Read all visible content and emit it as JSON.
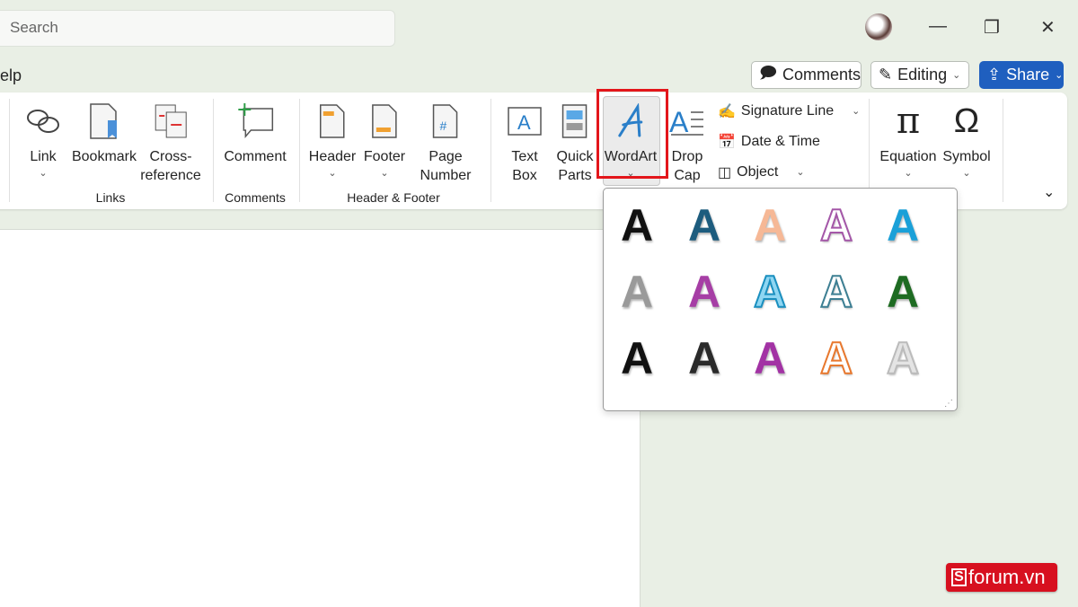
{
  "titlebar": {
    "search_placeholder": "Search",
    "minimize": "—",
    "restore": "❐",
    "close": "✕"
  },
  "menu": {
    "partial_tab": "elp"
  },
  "header_buttons": {
    "comments": "Comments",
    "editing": "Editing",
    "share": "Share",
    "chevron": "⌄"
  },
  "ribbon": {
    "link": "Link",
    "bookmark": "Bookmark",
    "cross1": "Cross-",
    "cross2": "reference",
    "comment": "Comment",
    "header": "Header",
    "footer": "Footer",
    "page1": "Page",
    "page2": "Number",
    "textbox1": "Text",
    "textbox2": "Box",
    "quick1": "Quick",
    "quick2": "Parts",
    "wordart": "WordArt",
    "drop1": "Drop",
    "drop2": "Cap",
    "signature": "Signature Line",
    "datetime": "Date & Time",
    "object": "Object",
    "equation": "Equation",
    "symbol": "Symbol",
    "groups": {
      "links": "Links",
      "comments": "Comments",
      "headerfooter": "Header & Footer"
    },
    "chev": "⌄",
    "collapse": "⌄"
  },
  "wordart_gallery": {
    "items": [
      {
        "letter": "A",
        "color": "#111111"
      },
      {
        "letter": "A",
        "color": "#1d5c7e"
      },
      {
        "letter": "A",
        "color": "#f6b896"
      },
      {
        "letter": "A",
        "color": "#ffffff",
        "outline": "#a457a8"
      },
      {
        "letter": "A",
        "color": "#1aa0d8"
      },
      {
        "letter": "A",
        "color": "#9a9a9a"
      },
      {
        "letter": "A",
        "color": "#a63ea5"
      },
      {
        "letter": "A",
        "color": "#8fd6f2",
        "outline": "#1a8fbf"
      },
      {
        "letter": "A",
        "color": "#ffffff",
        "outline": "#3d7f93"
      },
      {
        "letter": "A",
        "color": "#1e6b22"
      },
      {
        "letter": "A",
        "color": "#111111"
      },
      {
        "letter": "A",
        "color": "#2a2a2a"
      },
      {
        "letter": "A",
        "color": "#a232a4"
      },
      {
        "letter": "A",
        "color": "#ffffff",
        "outline": "#e8782e"
      },
      {
        "letter": "A",
        "color": "#e4e4e4",
        "outline": "#bbbbbb"
      }
    ]
  },
  "watermark": {
    "text": "forum.vn",
    "letter": "S"
  },
  "colors": {
    "accent": "#1f5fbf",
    "highlight": "#e3161b"
  }
}
